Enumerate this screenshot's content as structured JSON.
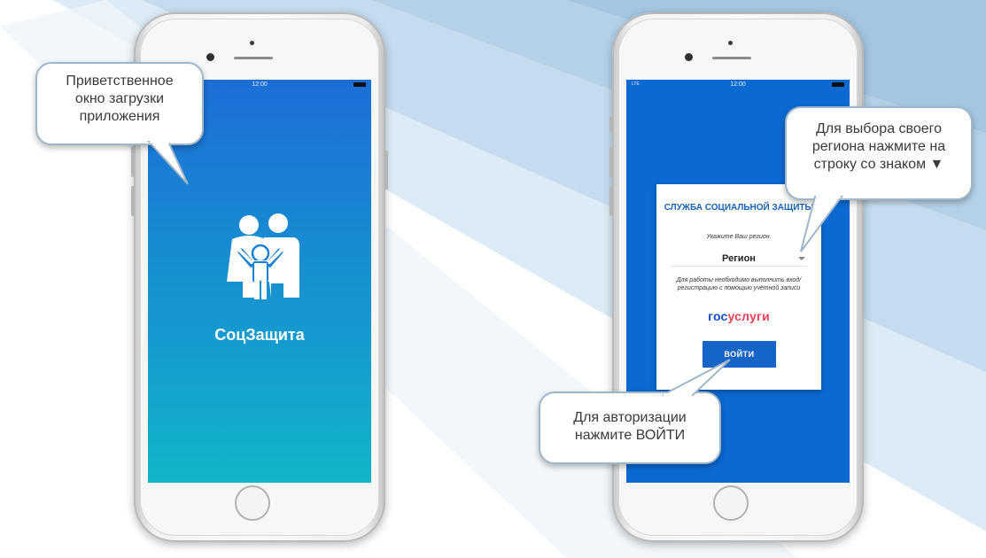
{
  "left_phone": {
    "status_time": "12:00",
    "app_name": "СоцЗащита",
    "logo_icon": "family-icon"
  },
  "right_phone": {
    "status_carrier": "LTE",
    "status_time": "12:00",
    "card": {
      "title": "СЛУЖБА СОЦИАЛЬНОЙ ЗАЩИТЫ",
      "subtitle": "Укажите Ваш регион.",
      "region_label": "Регион",
      "info_text": "Для работы необходимо выполнить вход/регистрацию с помощью учётной записи",
      "gosuslugi_part1": "гос",
      "gosuslugi_part2": "услуги",
      "login_button": "ВОЙТИ"
    }
  },
  "callouts": {
    "welcome": "Приветственное окно загрузки приложения",
    "region": "Для выбора своего региона нажмите на строку со знаком ▼",
    "login": "Для авторизации нажмите ВОЙТИ"
  },
  "colors": {
    "screen_top": "#1c6ed6",
    "screen_bottom": "#11b4c9",
    "card_title": "#1963b8",
    "login_button": "#1565c8",
    "gos_blue": "#0d4cd3",
    "gos_red": "#ee3f58",
    "callout_border": "#9fb6c8"
  }
}
